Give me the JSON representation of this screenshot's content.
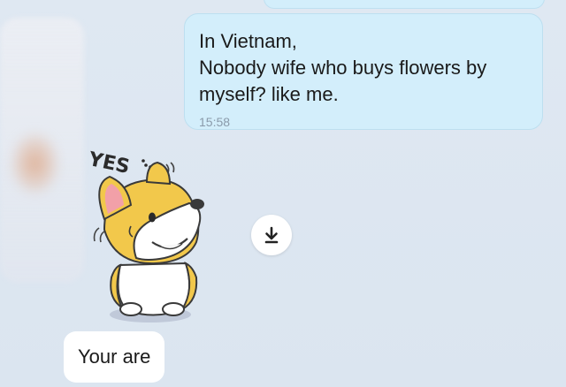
{
  "messages": {
    "outgoing": {
      "lines": [
        "In Vietnam,",
        "Nobody wife who buys flowers by",
        "myself? like me."
      ],
      "time": "15:58"
    },
    "sticker": {
      "caption": "YES",
      "description_icon": "corgi-sticker"
    },
    "incoming": {
      "text": "Your are"
    }
  },
  "icons": {
    "download": "download-icon"
  },
  "colors": {
    "background": "#dde6f1",
    "outgoing_bubble": "#d3eefb",
    "incoming_bubble": "#ffffff",
    "timestamp": "#8a9aaa"
  }
}
